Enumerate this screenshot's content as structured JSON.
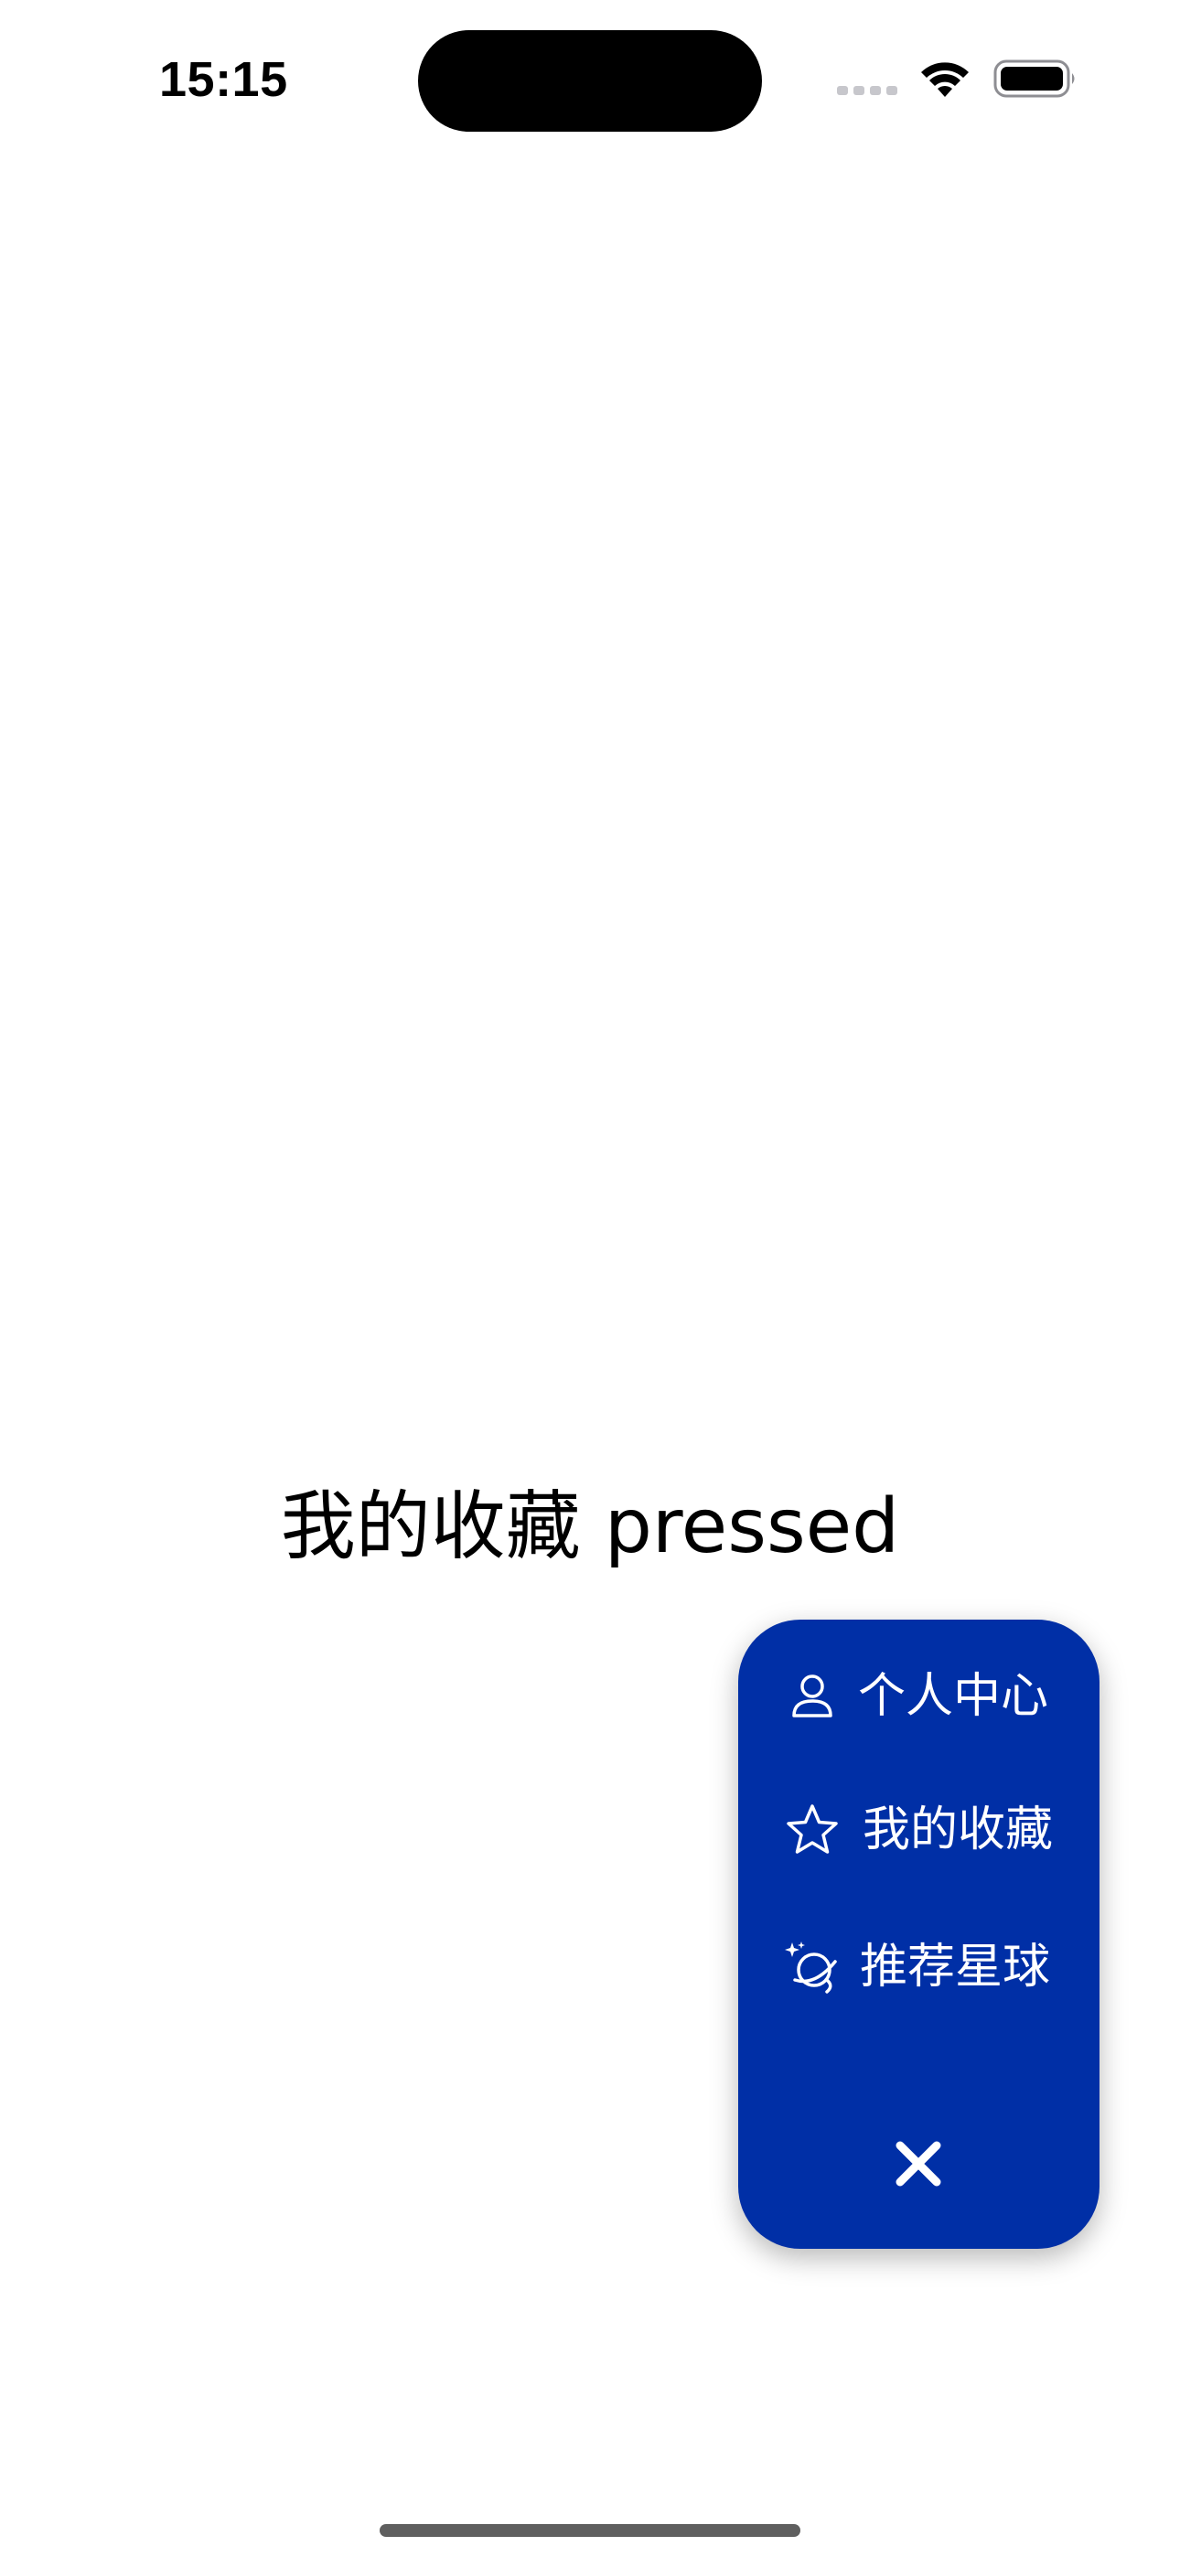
{
  "status_bar": {
    "time": "15:15",
    "wifi_icon": "wifi-icon",
    "battery_icon": "battery-full-icon",
    "signal_icon": "cellular-signal-icon"
  },
  "main": {
    "message": "我的收藏 pressed"
  },
  "menu": {
    "background_color": "#002fa6",
    "items": [
      {
        "label": "个人中心",
        "icon": "person-icon"
      },
      {
        "label": "我的收藏",
        "icon": "star-icon"
      },
      {
        "label": "推荐星球",
        "icon": "planet-sparkle-icon"
      }
    ],
    "close_icon": "close-icon"
  }
}
